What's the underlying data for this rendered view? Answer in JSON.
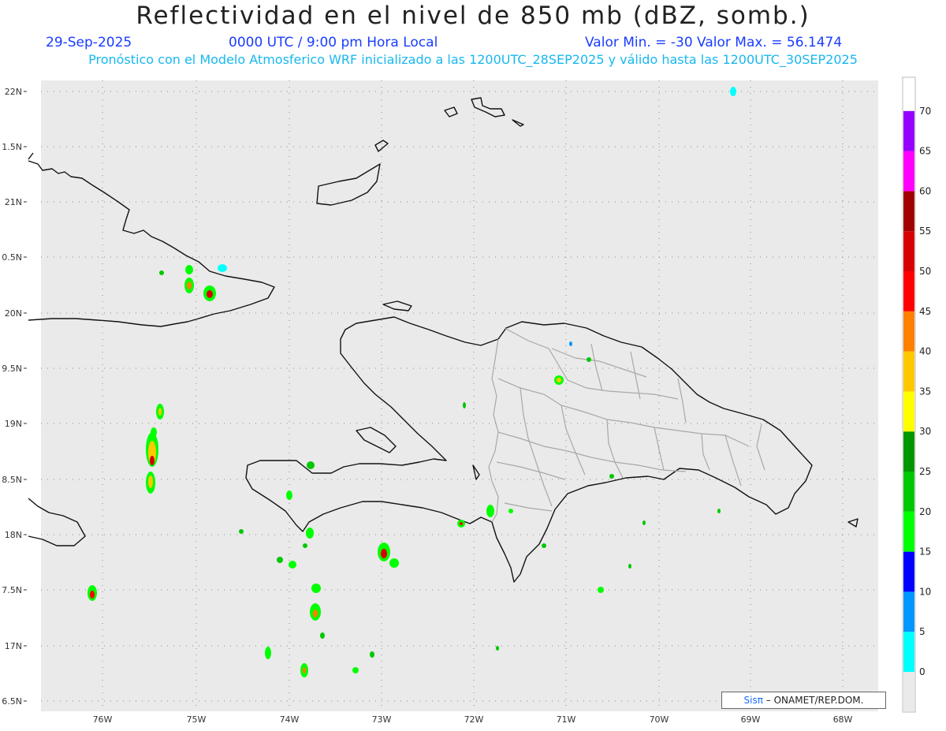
{
  "header": {
    "title": "Reflectividad en el nivel de 850 mb (dBZ, somb.)",
    "date": "29-Sep-2025",
    "time": "0000 UTC / 9:00 pm Hora Local",
    "min_max": "Valor Min. = -30  Valor Max. = 56.1474",
    "forecast_info": "Pronóstico con el Modelo Atmosferico WRF inicializado a las 1200UTC_28SEP2025 y válido hasta las  1200UTC_30SEP2025"
  },
  "axes": {
    "lat_labels": [
      "22N",
      "1.5N",
      "21N",
      "0.5N",
      "20N",
      "9.5N",
      "19N",
      "8.5N",
      "18N",
      "7.5N",
      "17N",
      "6.5N"
    ],
    "lon_labels": [
      "76W",
      "75W",
      "74W",
      "73W",
      "72W",
      "71W",
      "70W",
      "69W",
      "68W"
    ]
  },
  "colorbar": {
    "labels": [
      "0",
      "5",
      "10",
      "15",
      "20",
      "25",
      "30",
      "35",
      "40",
      "45",
      "50",
      "55",
      "60",
      "65",
      "70"
    ],
    "colors": [
      "#00ffff",
      "#0096ff",
      "#0000ff",
      "#00ff00",
      "#00c800",
      "#009600",
      "#ffff00",
      "#ffc800",
      "#ff8000",
      "#ff0000",
      "#d70000",
      "#a00000",
      "#ff00ff",
      "#9600ff"
    ]
  },
  "credit": {
    "brand": "Sisπ",
    "text": " – ONAMET/REP.DOM."
  },
  "colors": {
    "map_background": "#eaeaea",
    "coastline": "#111111",
    "provinces": "#a8a8a8",
    "grid": "#888888"
  }
}
